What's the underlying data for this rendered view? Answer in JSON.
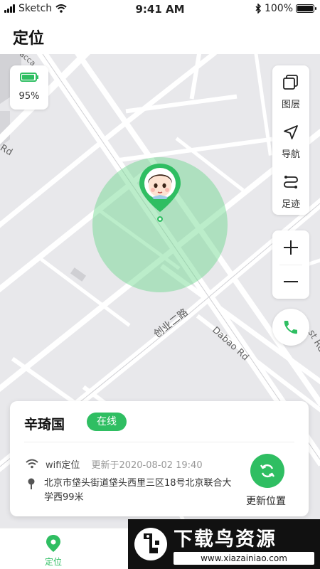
{
  "status_bar": {
    "carrier": "Sketch",
    "time": "9:41 AM",
    "battery": "100%"
  },
  "header": {
    "title": "定位"
  },
  "map": {
    "road_labels": {
      "chuangye_road": "创业二路",
      "dabao_road": "Dabao Rd",
      "rd_left": "Rd",
      "st_rd_right": "st Rd",
      "partial_top": "acca"
    },
    "device_battery": "95%",
    "device_battery_level": 0.95,
    "tools": {
      "layers": "图层",
      "navigate": "导航",
      "track": "足迹"
    },
    "accent_color": "#2fbe62",
    "geofence_color": "#68d68a"
  },
  "info_card": {
    "name": "辛琦国",
    "status": "在线",
    "location_type": "wifi定位",
    "updated": "更新于2020-08-02 19:40",
    "address": "北京市垡头街道垡头西里三区18号北京联合大学西99米",
    "refresh_label": "更新位置"
  },
  "tab_bar": {
    "location_tab": "定位"
  },
  "watermark": {
    "title": "下载鸟资源",
    "url": "www.xiazainiao.com"
  }
}
